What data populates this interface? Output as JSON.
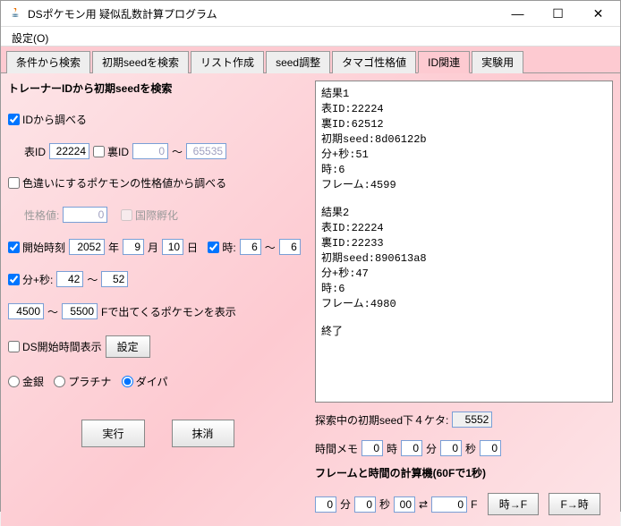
{
  "window": {
    "title": "DSポケモン用 疑似乱数計算プログラム"
  },
  "menu": {
    "settings": "設定(O)"
  },
  "tabs": {
    "t1": "条件から検索",
    "t2": "初期seedを検索",
    "t3": "リスト作成",
    "t4": "seed調整",
    "t5": "タマゴ性格値",
    "t6": "ID関連",
    "t7": "実験用"
  },
  "left": {
    "heading": "トレーナーIDから初期seedを検索",
    "chk_id": "IDから調べる",
    "label_tid": "表ID",
    "val_tid": "22224",
    "chk_sid": "裏ID",
    "val_sid": "0",
    "tilde": "～",
    "val_sid_max": "65535",
    "chk_shiny": "色違いにするポケモンの性格値から調べる",
    "label_pid": "性格値:",
    "val_pid": "0",
    "chk_intl": "国際孵化",
    "chk_start": "開始時刻",
    "val_year": "2052",
    "label_year": "年",
    "val_mon": "9",
    "label_mon": "月",
    "val_day": "10",
    "label_day": "日",
    "chk_hour": "時:",
    "val_h1": "6",
    "val_h2": "6",
    "chk_minsec": "分+秒:",
    "val_ms1": "42",
    "val_ms2": "52",
    "val_f1": "4500",
    "val_f2": "5500",
    "label_fshow": "Fで出てくるポケモンを表示",
    "chk_ds": "DS開始時間表示",
    "btn_set": "設定",
    "r_gs": "金銀",
    "r_pt": "プラチナ",
    "r_dp": "ダイパ",
    "btn_run": "実行",
    "btn_clr": "抹消"
  },
  "right": {
    "results": "結果1\n表ID:22224\n裏ID:62512\n初期seed:8d06122b\n分+秒:51\n時:6\nフレーム:4599\n\n結果2\n表ID:22224\n裏ID:22233\n初期seed:890613a8\n分+秒:47\n時:6\nフレーム:4980\n\n終了",
    "label_seed4": "探索中の初期seed下４ケタ:",
    "val_seed4": "5552",
    "label_memo": "時間メモ",
    "memo_h": "0",
    "u_h": "時",
    "memo_m": "0",
    "u_m": "分",
    "memo_s": "0",
    "u_s": "秒",
    "memo_x": "0",
    "label_calc": "フレームと時間の計算機(60Fで1秒)",
    "c_m": "0",
    "cu_m": "分",
    "c_s": "0",
    "cu_s": "秒",
    "c_ss": "00",
    "arrows": "⇄",
    "c_f": "0",
    "cu_f": "F",
    "btn_tf": "時→F",
    "btn_ft": "F→時"
  }
}
